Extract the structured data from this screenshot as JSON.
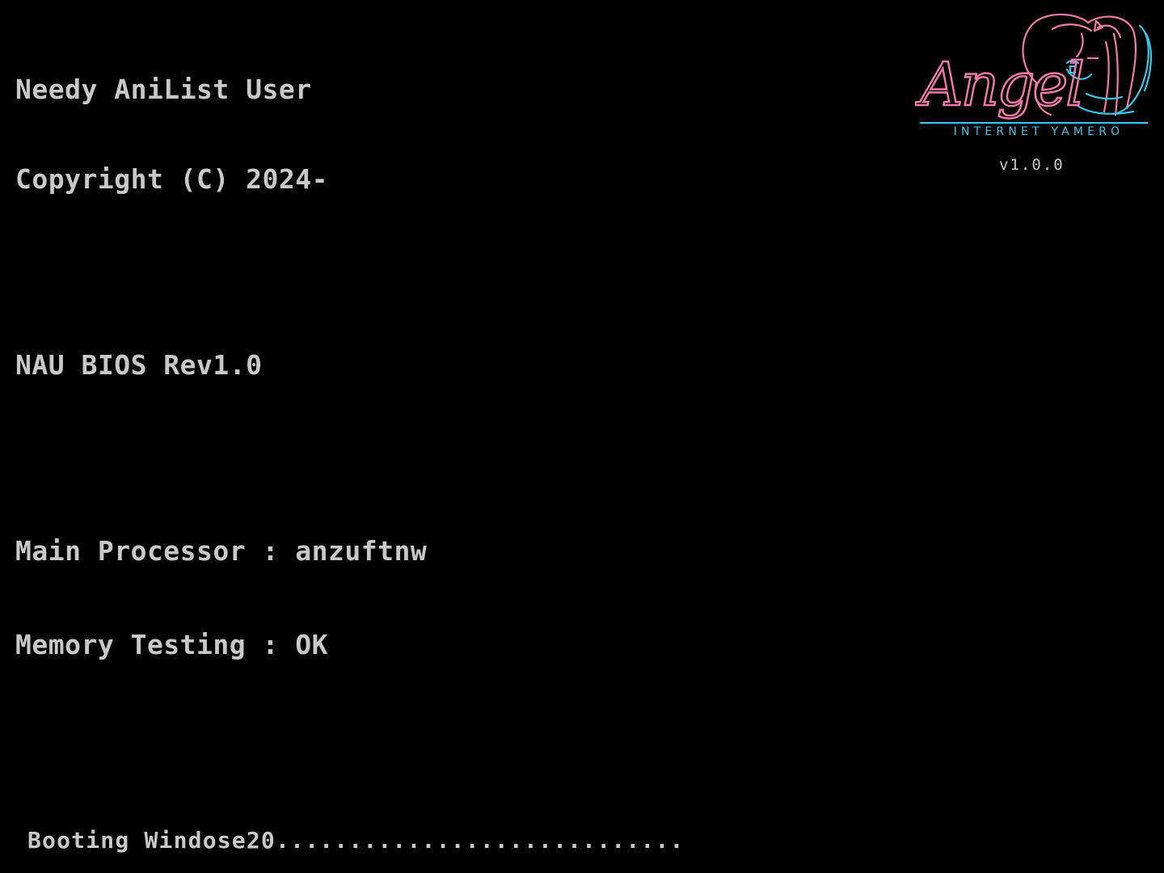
{
  "header": {
    "owner": "Needy AniList User",
    "copyright": "Copyright (C) 2024-"
  },
  "bios": {
    "revision": "NAU BIOS Rev1.0"
  },
  "system": {
    "processor": "Main Processor : anzuftnw",
    "memory": "Memory Testing : OK"
  },
  "logo": {
    "title": "Angel",
    "subtitle": "INTERNET YAMERO",
    "version": "v1.0.0",
    "colors": {
      "pink": "#f07aa8",
      "cyan": "#38c6e6"
    }
  },
  "boot": {
    "message": "Booting Windose20............................"
  }
}
